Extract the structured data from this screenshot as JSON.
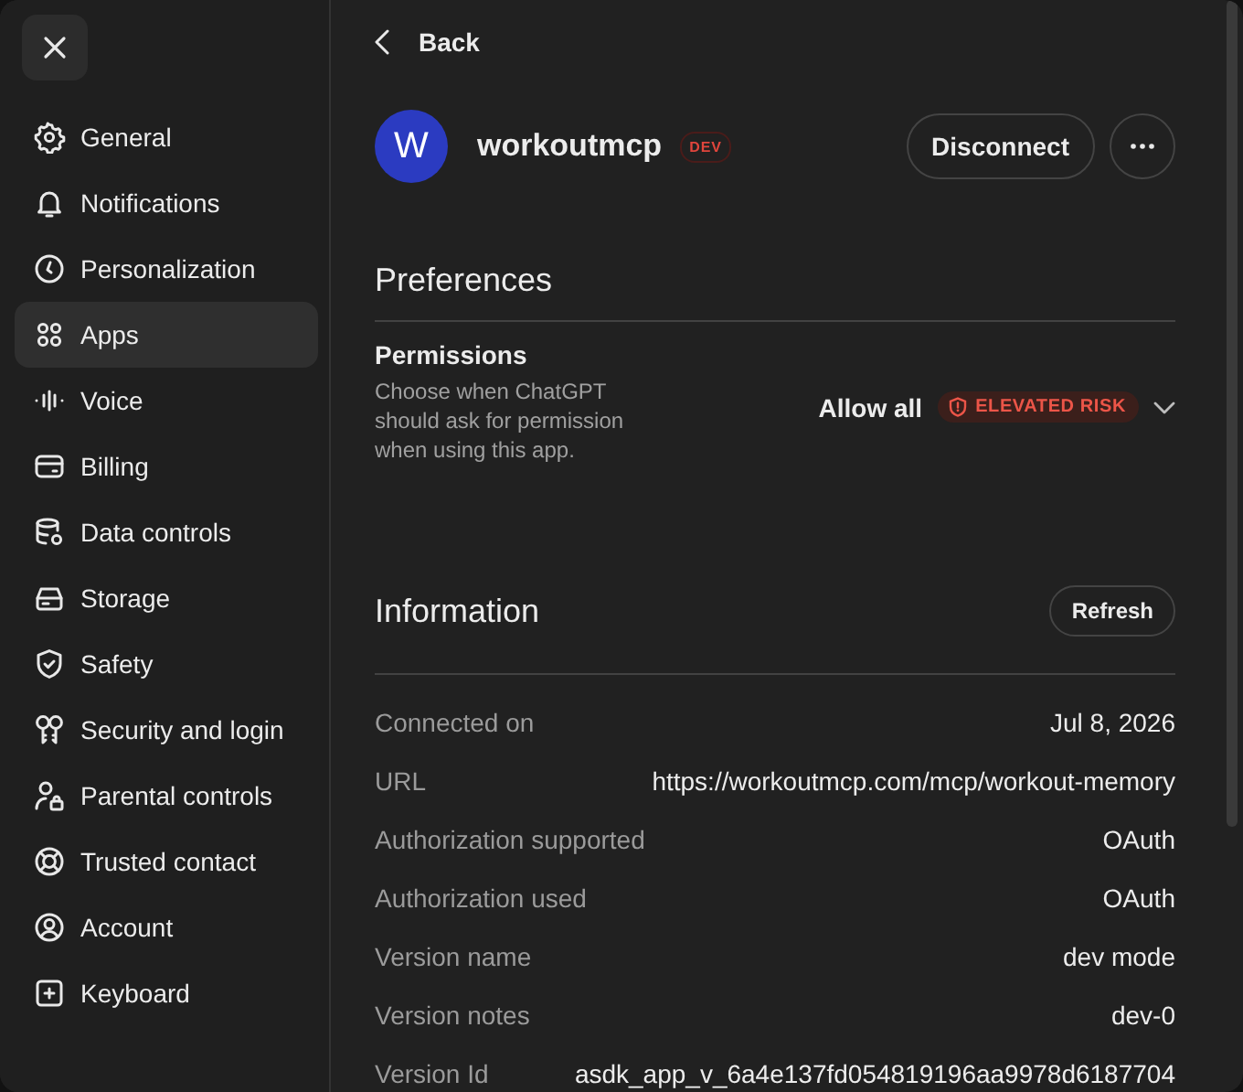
{
  "sidebar": {
    "items": [
      {
        "label": "General",
        "selected": false
      },
      {
        "label": "Notifications",
        "selected": false
      },
      {
        "label": "Personalization",
        "selected": false
      },
      {
        "label": "Apps",
        "selected": true
      },
      {
        "label": "Voice",
        "selected": false
      },
      {
        "label": "Billing",
        "selected": false
      },
      {
        "label": "Data controls",
        "selected": false
      },
      {
        "label": "Storage",
        "selected": false
      },
      {
        "label": "Safety",
        "selected": false
      },
      {
        "label": "Security and login",
        "selected": false
      },
      {
        "label": "Parental controls",
        "selected": false
      },
      {
        "label": "Trusted contact",
        "selected": false
      },
      {
        "label": "Account",
        "selected": false
      },
      {
        "label": "Keyboard",
        "selected": false
      }
    ]
  },
  "back_link": "Back",
  "app": {
    "avatar_letter": "W",
    "name": "workoutmcp",
    "badge": "DEV",
    "disconnect_button": "Disconnect"
  },
  "preferences": {
    "title": "Preferences",
    "permissions": {
      "title": "Permissions",
      "description": "Choose when ChatGPT should ask for permission when using this app.",
      "value": "Allow all",
      "risk_badge": "ELEVATED RISK"
    }
  },
  "information": {
    "title": "Information",
    "refresh_button": "Refresh",
    "rows": [
      {
        "label": "Connected on",
        "value": "Jul 8, 2026"
      },
      {
        "label": "URL",
        "value": "https://workoutmcp.com/mcp/workout-memory"
      },
      {
        "label": "Authorization supported",
        "value": "OAuth"
      },
      {
        "label": "Authorization used",
        "value": "OAuth"
      },
      {
        "label": "Version name",
        "value": "dev mode"
      },
      {
        "label": "Version notes",
        "value": "dev-0"
      },
      {
        "label": "Version Id",
        "value": "asdk_app_v_6a4e137fd054819196aa9978d6187704"
      }
    ]
  }
}
